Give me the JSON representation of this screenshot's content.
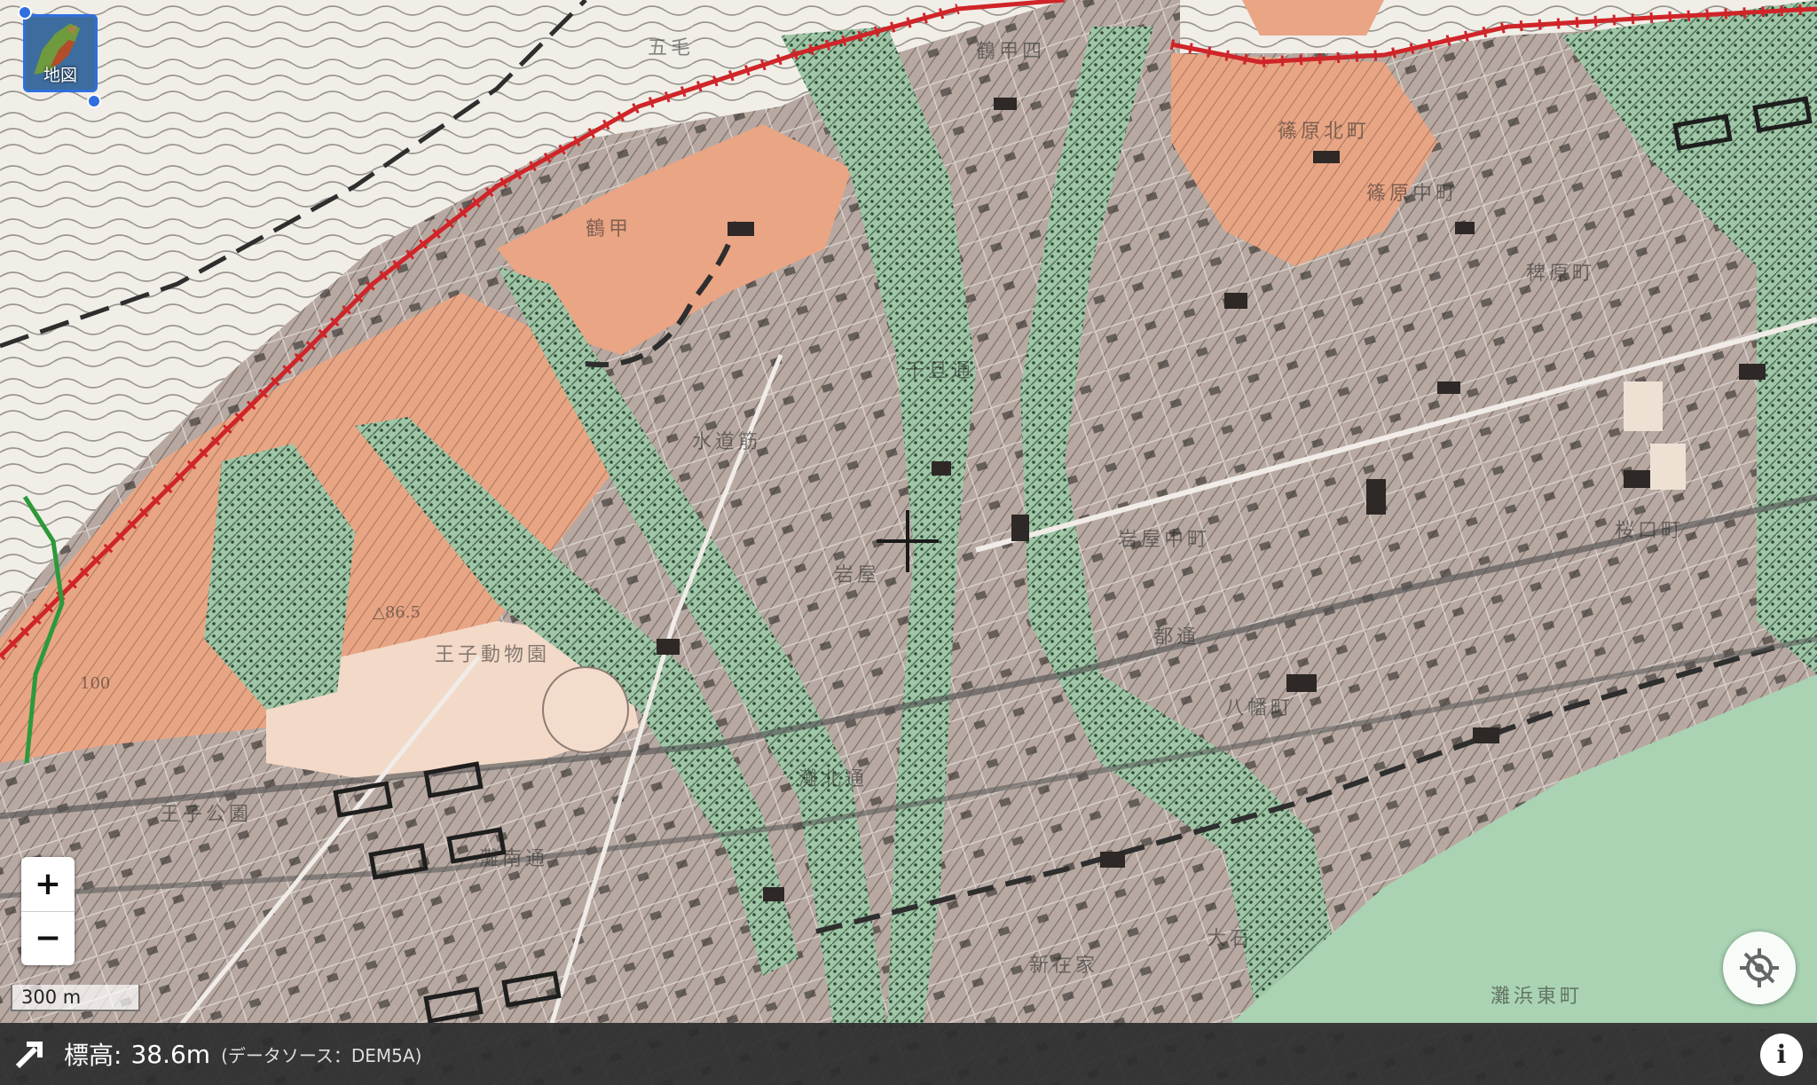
{
  "layer_button": {
    "label": "地図",
    "icon": "map-layer-icon"
  },
  "map": {
    "labels": [
      "五毛",
      "篠原北町",
      "鶴甲",
      "水道筋",
      "王子動物園",
      "篠原中町",
      "灘北通",
      "灘南通",
      "王子公園",
      "岩屋",
      "岩屋中町",
      "都通",
      "大石",
      "灘浜東町",
      "新在家",
      "八幡町",
      "桜口町",
      "鶴甲四",
      "稗原町",
      "千旦通"
    ],
    "spot_height": "△86.5",
    "contour_value": "100"
  },
  "zoom": {
    "in_label": "+",
    "out_label": "−"
  },
  "scale": {
    "label": "300 m"
  },
  "crosshair": {
    "icon": "crosshair-icon"
  },
  "locate": {
    "icon": "locate-off-icon"
  },
  "info_bar": {
    "expand_icon": "expand-arrow-icon",
    "elevation_label": "標高:",
    "elevation_value": "38.6m",
    "source": "(データソース：DEM5A)",
    "info_label": "i"
  },
  "colors": {
    "terrace": "#e9a98a",
    "lowland": "#b8aaa3",
    "valley": "#a7cfae",
    "fault": "#d1272b",
    "mountain": "#f2efe9"
  }
}
